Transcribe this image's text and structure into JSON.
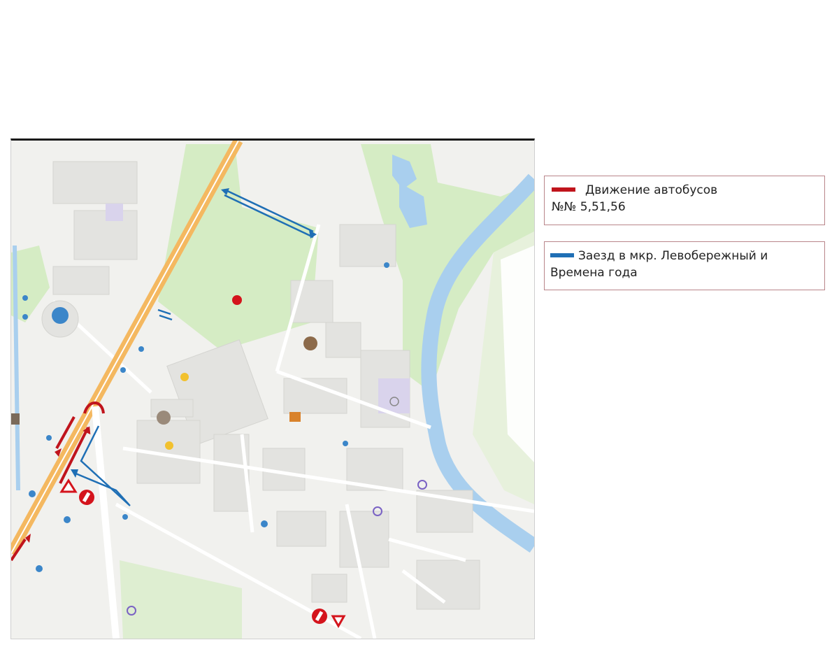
{
  "legend": {
    "bus_route": {
      "line1": "Движение автобусов",
      "line2": "№№ 5,51,56",
      "color": "#c0141c"
    },
    "entry_route": {
      "line1": "Заезд в мкр. Левобережный и",
      "line2": "Времена года",
      "color": "#1f6fb5"
    }
  },
  "colors": {
    "park": "#d5ecc4",
    "water": "#a9cfee",
    "road_major": "#f4b860",
    "block": "#e3e3e0",
    "bus_route": "#c0141c",
    "entry_route": "#1f6fb5",
    "poi_orange": "#d9822b"
  },
  "icons": [
    "no-entry-sign-icon",
    "yield-sign-icon",
    "bus-stop-icon",
    "poi-marker-icon",
    "u-turn-arrow-icon"
  ]
}
